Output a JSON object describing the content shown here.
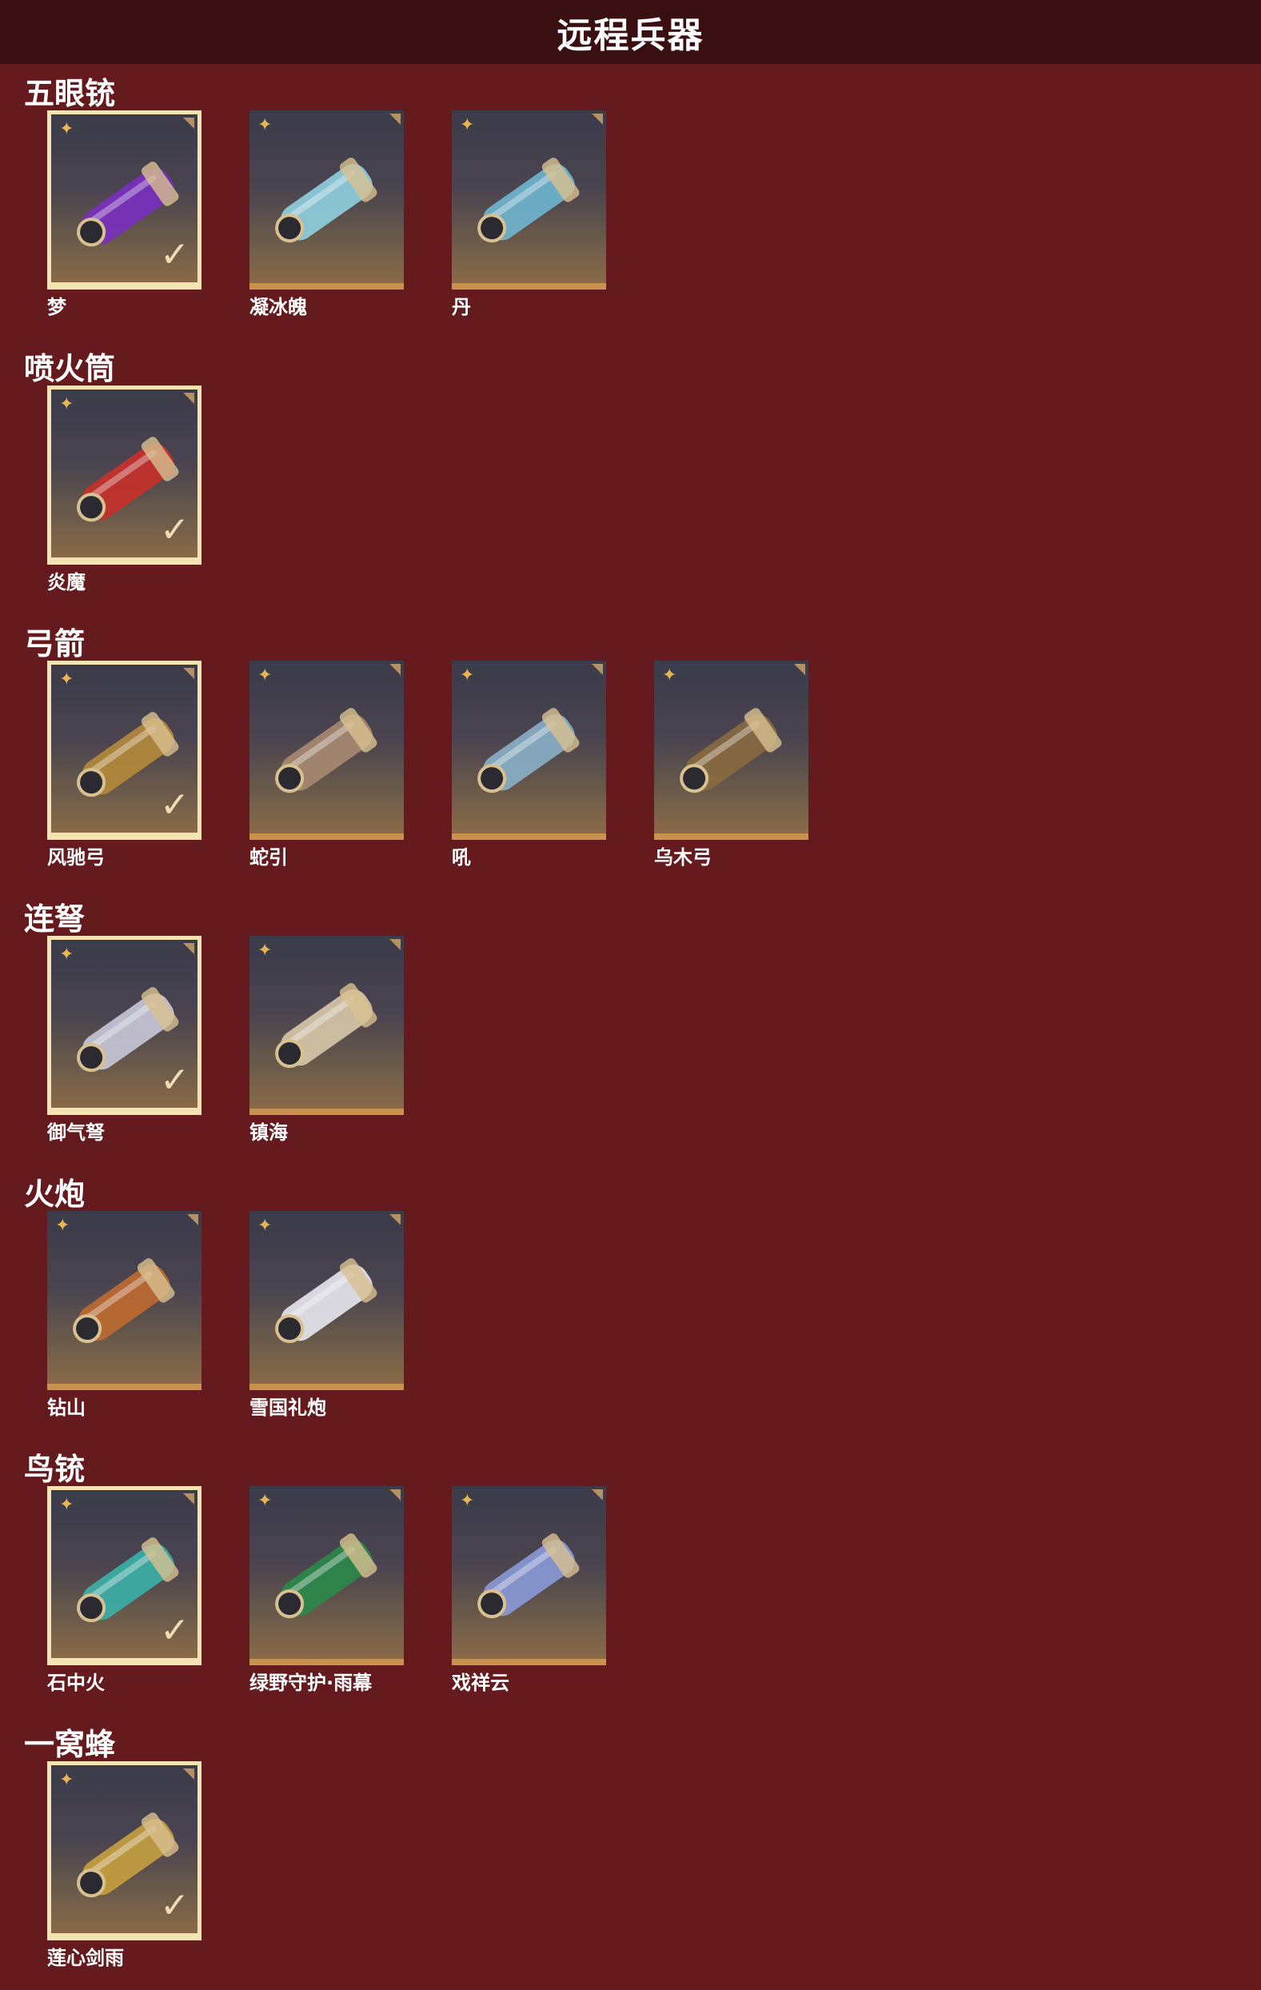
{
  "page": {
    "title": "远程兵器"
  },
  "ui": {
    "star_glyph": "✦",
    "check_glyph": "✓"
  },
  "sections": [
    {
      "title": "五眼铳",
      "items": [
        {
          "name": "梦",
          "equipped": true,
          "icon": "purple-dragon-cannon-icon",
          "color": "#7a2fc0"
        },
        {
          "name": "凝冰魄",
          "equipped": false,
          "icon": "ice-gatling-icon",
          "color": "#8fd0e0"
        },
        {
          "name": "丹",
          "equipped": false,
          "icon": "ice-blue-cannon-icon",
          "color": "#6fb6d0"
        }
      ]
    },
    {
      "title": "喷火筒",
      "items": [
        {
          "name": "炎魔",
          "equipped": true,
          "icon": "flame-demon-launcher-icon",
          "color": "#c8302a"
        }
      ]
    },
    {
      "title": "弓箭",
      "items": [
        {
          "name": "风驰弓",
          "equipped": true,
          "icon": "golden-bow-quiver-icon",
          "color": "#b58a3a"
        },
        {
          "name": "蛇引",
          "equipped": false,
          "icon": "serpent-bow-icon",
          "color": "#a88a70"
        },
        {
          "name": "吼",
          "equipped": false,
          "icon": "roar-bow-icon",
          "color": "#8ab0c8"
        },
        {
          "name": "乌木弓",
          "equipped": false,
          "icon": "ebony-bow-icon",
          "color": "#8a6a40"
        }
      ]
    },
    {
      "title": "连弩",
      "items": [
        {
          "name": "御气弩",
          "equipped": true,
          "icon": "qi-crossbow-icon",
          "color": "#c8c8d8"
        },
        {
          "name": "镇海",
          "equipped": false,
          "icon": "sea-crossbow-icon",
          "color": "#d8c8a8"
        }
      ]
    },
    {
      "title": "火炮",
      "items": [
        {
          "name": "钻山",
          "equipped": false,
          "icon": "drill-cannon-icon",
          "color": "#c06a30"
        },
        {
          "name": "雪国礼炮",
          "equipped": false,
          "icon": "snow-salute-cannon-icon",
          "color": "#e8e8f0"
        }
      ]
    },
    {
      "title": "鸟铳",
      "items": [
        {
          "name": "石中火",
          "equipped": true,
          "icon": "jade-musket-icon",
          "color": "#3ab0a8"
        },
        {
          "name": "绿野守护·雨幕",
          "equipped": false,
          "icon": "green-guardian-musket-icon",
          "color": "#2a8a4a"
        },
        {
          "name": "戏祥云",
          "equipped": false,
          "icon": "cloud-musket-icon",
          "color": "#8a9ad8"
        }
      ]
    },
    {
      "title": "一窝蜂",
      "items": [
        {
          "name": "莲心剑雨",
          "equipped": true,
          "icon": "lotus-rocket-launcher-icon",
          "color": "#c8a040"
        }
      ]
    }
  ]
}
